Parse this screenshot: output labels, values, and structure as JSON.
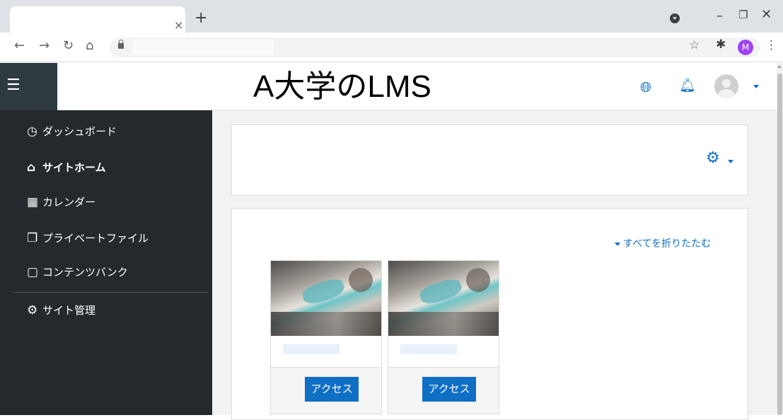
{
  "browser": {
    "tab_close": "×",
    "new_tab": "+",
    "profile_initial": "M"
  },
  "header": {
    "menu_icon": "hamburger-icon",
    "site_title": "A大学のLMS",
    "language_icon": "globe-icon",
    "notifications_icon": "bell-icon",
    "user_icon": "avatar"
  },
  "sidebar": {
    "items": [
      {
        "label": "ダッシュボード",
        "icon": "dashboard-icon"
      },
      {
        "label": "サイトホーム",
        "icon": "home-icon",
        "active": true
      },
      {
        "label": "カレンダー",
        "icon": "calendar-icon"
      },
      {
        "label": "プライベートファイル",
        "icon": "files-icon"
      },
      {
        "label": "コンテンツバンク",
        "icon": "clipboard-icon"
      }
    ],
    "admin_item": {
      "label": "サイト管理",
      "icon": "gear-icon"
    }
  },
  "main": {
    "actions_icon": "gear-icon",
    "collapse_all": "すべてを折りたたむ",
    "courses": [
      {
        "image": "watercolor-painting-image",
        "button": "アクセス"
      },
      {
        "image": "watercolor-painting-image",
        "button": "アクセス"
      }
    ]
  },
  "colors": {
    "sidebar_bg": "#23292c",
    "accent": "#0f6fc5",
    "navbar_bg": "#ffffff",
    "main_bg": "#f2f2f2"
  }
}
